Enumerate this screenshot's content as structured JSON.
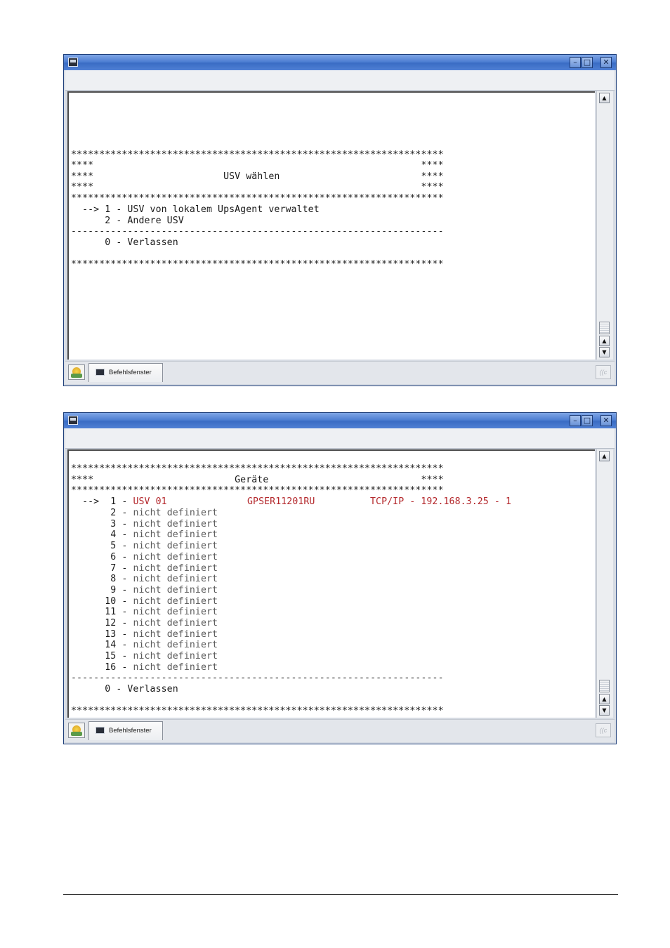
{
  "window_1": {
    "controls": {
      "minimize": "–",
      "maximize": "□",
      "close": "✕"
    },
    "screen_lines": [
      "******************************************************************",
      "****                                                          ****",
      "****                       USV wählen                         ****",
      "****                                                          ****",
      "******************************************************************",
      "  --> 1 - USV von lokalem UpsAgent verwaltet",
      "      2 - Andere USV",
      "------------------------------------------------------------------",
      "      0 - Verlassen",
      "******************************************************************"
    ],
    "taskbar": {
      "task_label": "Befehlsfenster",
      "tray_icon": "((c"
    }
  },
  "window_2": {
    "controls": {
      "minimize": "–",
      "maximize": "□",
      "close": "✕"
    },
    "header_lines": [
      "******************************************************************",
      "****                         Geräte                           ****",
      "******************************************************************"
    ],
    "selected_row": {
      "prefix": "  -->  1 - ",
      "name": "USV 01",
      "serial": "GPSER11201RU",
      "connection": "TCP/IP - 192.168.3.25 - 1"
    },
    "device_rows": [
      {
        "num": " 2",
        "text": "nicht definiert"
      },
      {
        "num": " 3",
        "text": "nicht definiert"
      },
      {
        "num": " 4",
        "text": "nicht definiert"
      },
      {
        "num": " 5",
        "text": "nicht definiert"
      },
      {
        "num": " 6",
        "text": "nicht definiert"
      },
      {
        "num": " 7",
        "text": "nicht definiert"
      },
      {
        "num": " 8",
        "text": "nicht definiert"
      },
      {
        "num": " 9",
        "text": "nicht definiert"
      },
      {
        "num": "10",
        "text": "nicht definiert"
      },
      {
        "num": "11",
        "text": "nicht definiert"
      },
      {
        "num": "12",
        "text": "nicht definiert"
      },
      {
        "num": "13",
        "text": "nicht definiert"
      },
      {
        "num": "14",
        "text": "nicht definiert"
      },
      {
        "num": "15",
        "text": "nicht definiert"
      },
      {
        "num": "16",
        "text": "nicht definiert"
      }
    ],
    "footer_lines": [
      "------------------------------------------------------------------",
      "      0 - Verlassen",
      "******************************************************************"
    ],
    "taskbar": {
      "task_label": "Befehlsfenster",
      "tray_icon": "((c"
    }
  },
  "colors": {
    "title_gradient": "#4e7fd2",
    "highlight_text": "#b3262a",
    "terminal_bg": "#ffffff"
  },
  "icons": [
    "terminal-window-icon",
    "start-menu-icon",
    "task-terminal-icon",
    "tray-network-icon"
  ]
}
